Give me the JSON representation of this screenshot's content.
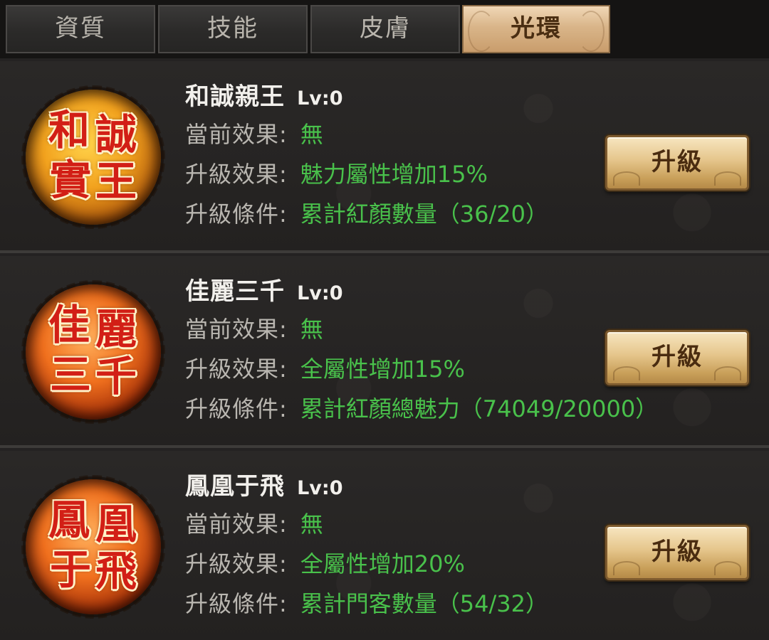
{
  "tabs": [
    {
      "label": "資質",
      "active": false
    },
    {
      "label": "技能",
      "active": false
    },
    {
      "label": "皮膚",
      "active": false
    },
    {
      "label": "光環",
      "active": true
    }
  ],
  "labels": {
    "current": "當前效果:",
    "upgrade_effect": "升級效果:",
    "upgrade_condition": "升級條件:",
    "button": "升級"
  },
  "auras": [
    {
      "name": "和誠親王",
      "level": "Lv:0",
      "current_effect": "無",
      "upgrade_effect": "魅力屬性增加15%",
      "upgrade_condition": "累計紅顏數量（36/20）",
      "medallion_text": [
        "和",
        "誠",
        "實",
        "王"
      ],
      "medallion_style": "gold"
    },
    {
      "name": "佳麗三千",
      "level": "Lv:0",
      "current_effect": "無",
      "upgrade_effect": "全屬性增加15%",
      "upgrade_condition": "累計紅顏總魅力（74049/20000）",
      "medallion_text": [
        "佳",
        "麗",
        "三",
        "千"
      ],
      "medallion_style": "red"
    },
    {
      "name": "鳳凰于飛",
      "level": "Lv:0",
      "current_effect": "無",
      "upgrade_effect": "全屬性增加20%",
      "upgrade_condition": "累計門客數量（54/32）",
      "medallion_text": [
        "鳳",
        "凰",
        "于",
        "飛"
      ],
      "medallion_style": "red"
    }
  ]
}
